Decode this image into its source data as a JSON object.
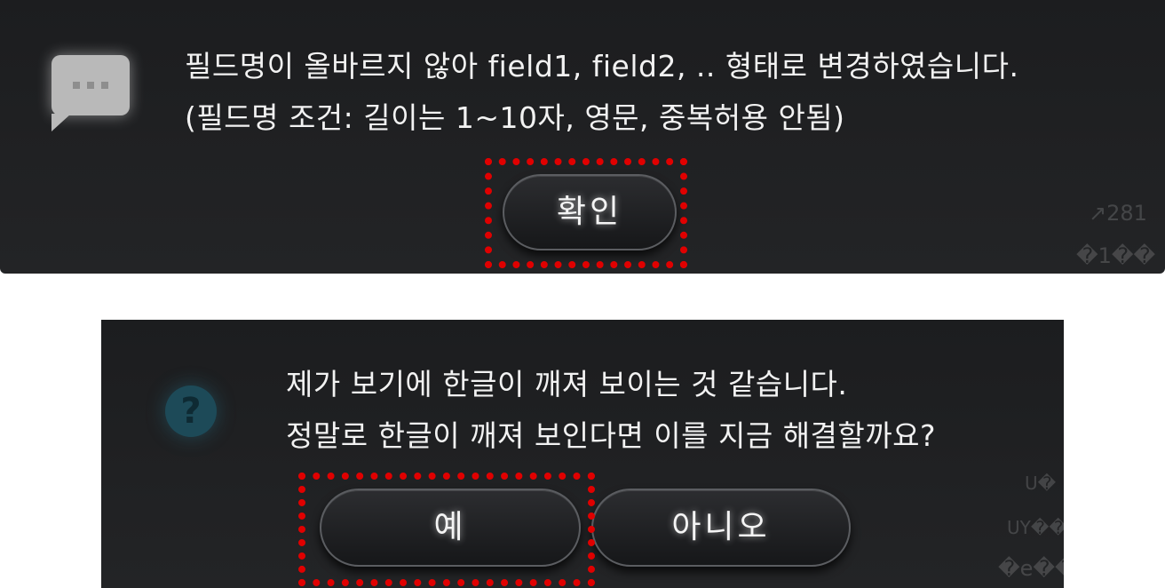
{
  "dialog_top": {
    "icon": "chat-bubble-icon",
    "message_lines": [
      "필드명이 올바르지 않아 field1, field2, .. 형태로 변경하였습니다.",
      "(필드명 조건: 길이는 1~10자, 영문, 중복허용 안됨)"
    ],
    "confirm_label": "확인",
    "background_text": [
      "↗281",
      "�1��"
    ]
  },
  "dialog_bottom": {
    "icon": "question-icon",
    "icon_glyph": "?",
    "message_lines": [
      "제가 보기에 한글이 깨져 보이는 것 같습니다.",
      "정말로 한글이 깨져 보인다면 이를 지금 해결할까요?"
    ],
    "yes_label": "예",
    "no_label": "아니오",
    "background_text": [
      "U�",
      "UY��",
      "�e��"
    ]
  },
  "colors": {
    "dialog_bg": "#1e1f21",
    "button_border": "#5b5d61",
    "text": "#f2f2f2",
    "highlight": "#e00000",
    "question_icon": "#1d4a58"
  }
}
